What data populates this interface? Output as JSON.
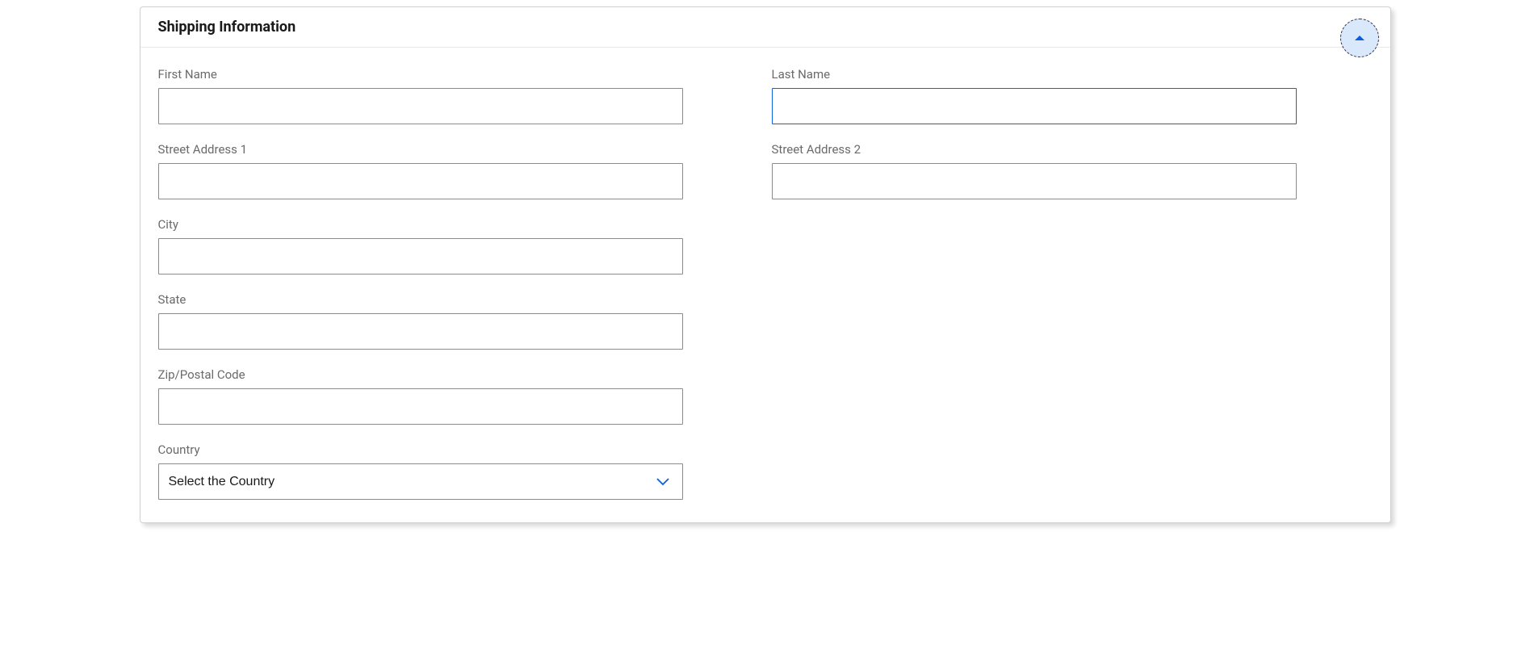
{
  "panel": {
    "title": "Shipping Information"
  },
  "fields": {
    "first_name": {
      "label": "First Name",
      "value": ""
    },
    "last_name": {
      "label": "Last Name",
      "value": ""
    },
    "street_address_1": {
      "label": "Street Address 1",
      "value": ""
    },
    "street_address_2": {
      "label": "Street Address 2",
      "value": ""
    },
    "city": {
      "label": "City",
      "value": ""
    },
    "state": {
      "label": "State",
      "value": ""
    },
    "zip": {
      "label": "Zip/Postal Code",
      "value": ""
    },
    "country": {
      "label": "Country",
      "placeholder": "Select the Country"
    }
  }
}
